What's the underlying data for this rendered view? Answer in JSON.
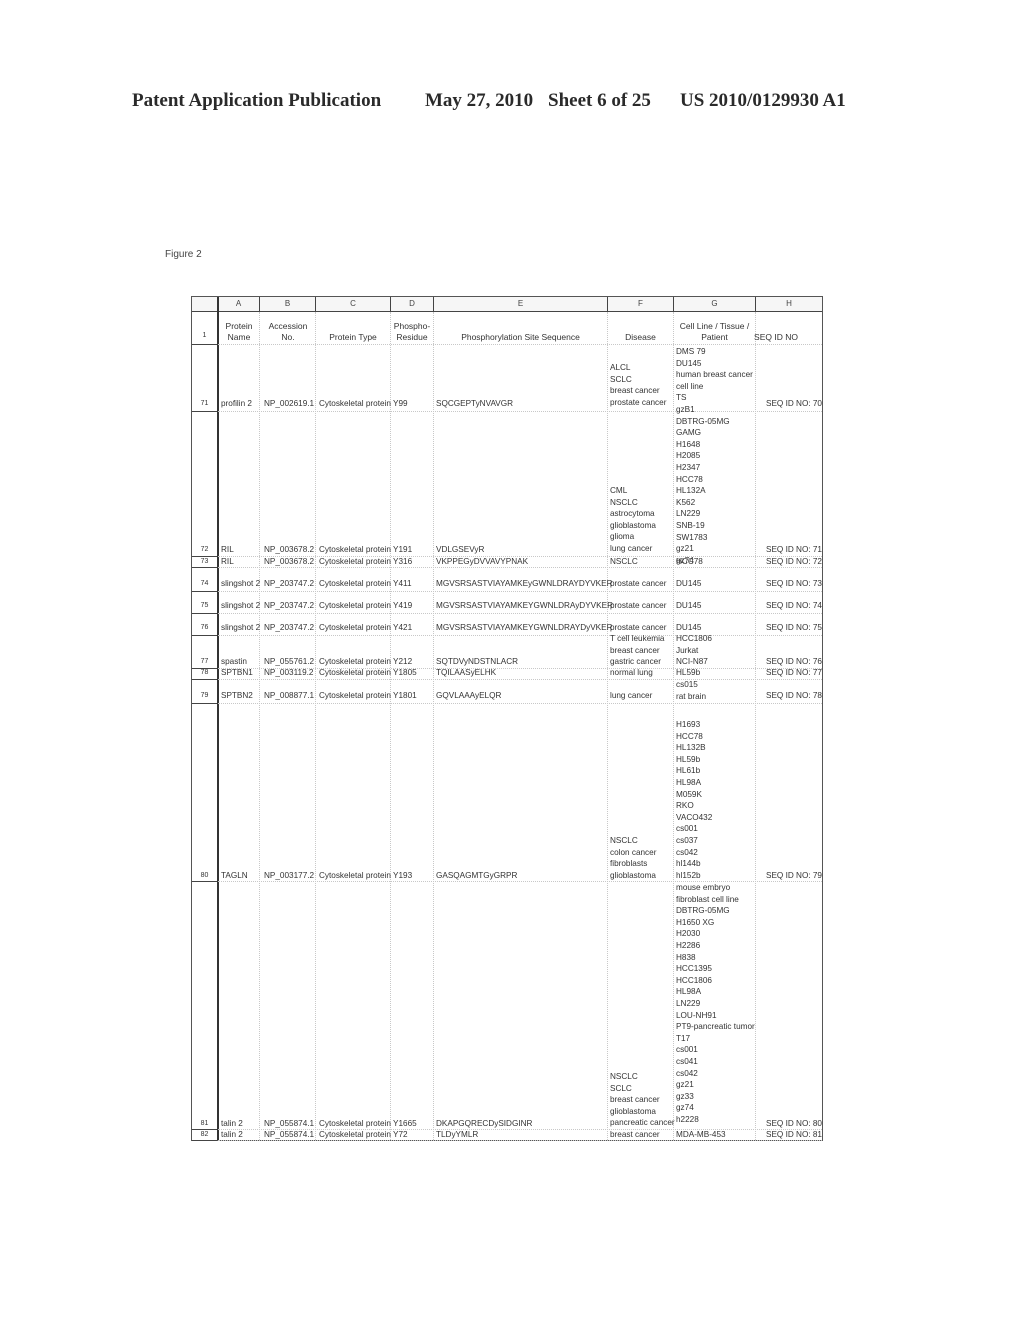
{
  "page_header": {
    "publication": "Patent Application Publication",
    "date": "May 27, 2010",
    "sheet": "Sheet 6 of 25",
    "patent_number": "US 2010/0129930 A1"
  },
  "figure_label": "Figure 2",
  "table": {
    "column_letters": [
      "A",
      "B",
      "C",
      "D",
      "E",
      "F",
      "G",
      "H"
    ],
    "header_row_number": "1",
    "headers": {
      "protein_name": "Protein Name",
      "accession_no": "Accession No.",
      "protein_type": "Protein Type",
      "phospho_residue": "Phospho-Residue",
      "sequence": "Phosphorylation Site Sequence",
      "disease": "Disease",
      "cell_line": "Cell Line / Tissue / Patient",
      "seq_id": "SEQ ID NO"
    },
    "rows": [
      {
        "num": "71",
        "protein": "profilin 2",
        "accession": "NP_002619.1",
        "type": "Cytoskeletal protein",
        "residue": "Y99",
        "sequence": "SQCGEPTyNVAVGR",
        "disease": [
          "ALCL",
          "SCLC",
          "breast cancer",
          "prostate cancer"
        ],
        "cell_lines": [
          "DMS 79",
          "DU145",
          "human breast cancer",
          "cell line",
          "TS",
          "gzB1",
          "DBTRG-05MG",
          "GAMG",
          "H1648",
          "H2085",
          "H2347",
          "HCC78",
          "HL132A",
          "K562",
          "LN229",
          "SNB-19",
          "SW1783",
          "gz21",
          "gz74"
        ],
        "seq_id": "SEQ ID NO: 70"
      },
      {
        "num": "72",
        "protein": "RIL",
        "accession": "NP_003678.2",
        "type": "Cytoskeletal protein",
        "residue": "Y191",
        "sequence": "VDLGSEVyR",
        "disease": [
          "CML",
          "NSCLC",
          "astrocytoma",
          "glioblastoma",
          "glioma",
          "lung cancer"
        ],
        "cell_lines": [],
        "seq_id": "SEQ ID NO: 71"
      },
      {
        "num": "73",
        "protein": "RIL",
        "accession": "NP_003678.2",
        "type": "Cytoskeletal protein",
        "residue": "Y316",
        "sequence": "VKPPEGyDVVAVYPNAK",
        "disease": [
          "NSCLC"
        ],
        "cell_lines": [
          "HCC78"
        ],
        "seq_id": "SEQ ID NO: 72"
      },
      {
        "num": "74",
        "protein": "slingshot 2",
        "accession": "NP_203747.2",
        "type": "Cytoskeletal protein",
        "residue": "Y411",
        "sequence": "MGVSRSASTVIAYAMKEyGWNLDRAYDYVKER",
        "disease": [
          "prostate cancer"
        ],
        "cell_lines": [
          "DU145"
        ],
        "seq_id": "SEQ ID NO: 73"
      },
      {
        "num": "75",
        "protein": "slingshot 2",
        "accession": "NP_203747.2",
        "type": "Cytoskeletal protein",
        "residue": "Y419",
        "sequence": "MGVSRSASTVIAYAMKEYGWNLDRAyDYVKER",
        "disease": [
          "prostate cancer"
        ],
        "cell_lines": [
          "DU145"
        ],
        "seq_id": "SEQ ID NO: 74"
      },
      {
        "num": "76",
        "protein": "slingshot 2",
        "accession": "NP_203747.2",
        "type": "Cytoskeletal protein",
        "residue": "Y421",
        "sequence": "MGVSRSASTVIAYAMKEYGWNLDRAYDyVKER",
        "disease": [
          "prostate cancer"
        ],
        "cell_lines": [
          "DU145"
        ],
        "seq_id": "SEQ ID NO: 75"
      },
      {
        "num": "77",
        "protein": "spastin",
        "accession": "NP_055761.2",
        "type": "Cytoskeletal protein",
        "residue": "Y212",
        "sequence": "SQTDVyNDSTNLACR",
        "disease": [
          "T cell leukemia",
          "breast cancer",
          "gastric cancer"
        ],
        "cell_lines": [
          "HCC1806",
          "Jurkat",
          "NCI-N87"
        ],
        "seq_id": "SEQ ID NO: 76"
      },
      {
        "num": "78",
        "protein": "SPTBN1",
        "accession": "NP_003119.2",
        "type": "Cytoskeletal protein",
        "residue": "Y1805",
        "sequence": "TQILAASyELHK",
        "disease": [
          "normal lung"
        ],
        "cell_lines": [
          "HL59b"
        ],
        "seq_id": "SEQ ID NO: 77"
      },
      {
        "num": "79",
        "protein": "SPTBN2",
        "accession": "NP_008877.1",
        "type": "Cytoskeletal protein",
        "residue": "Y1801",
        "sequence": "GQVLAAAyELQR",
        "disease": [
          "lung cancer"
        ],
        "cell_lines": [
          "cs015",
          "rat brain"
        ],
        "seq_id": "SEQ ID NO: 78"
      },
      {
        "num": "80",
        "protein": "TAGLN",
        "accession": "NP_003177.2",
        "type": "Cytoskeletal protein",
        "residue": "Y193",
        "sequence": "GASQAGMTGyGRPR",
        "disease": [
          "NSCLC",
          "colon cancer",
          "fibroblasts",
          "glioblastoma"
        ],
        "cell_lines": [
          "H1693",
          "HCC78",
          "HL132B",
          "HL59b",
          "HL61b",
          "HL98A",
          "M059K",
          "RKO",
          "VACO432",
          "cs001",
          "cs037",
          "cs042",
          "hl144b",
          "hl152b"
        ],
        "seq_id": "SEQ ID NO: 79"
      },
      {
        "num": "81",
        "protein": "talin 2",
        "accession": "NP_055874.1",
        "type": "Cytoskeletal protein",
        "residue": "Y1665",
        "sequence": "DKAPGQRECDySIDGINR",
        "disease": [
          "NSCLC",
          "SCLC",
          "breast cancer",
          "glioblastoma",
          "pancreatic cancer"
        ],
        "cell_lines": [
          "mouse embryo",
          "fibroblast cell line",
          "DBTRG-05MG",
          "H1650 XG",
          "H2030",
          "H2286",
          "H838",
          "HCC1395",
          "HCC1806",
          "HL98A",
          "LN229",
          "LOU-NH91",
          "PT9-pancreatic tumor",
          "T17",
          "cs001",
          "cs041",
          "cs042",
          "gz21",
          "gz33",
          "gz74",
          "h2228"
        ],
        "seq_id": "SEQ ID NO: 80"
      },
      {
        "num": "82",
        "protein": "talin 2",
        "accession": "NP_055874.1",
        "type": "Cytoskeletal protein",
        "residue": "Y72",
        "sequence": "TLDyYMLR",
        "disease": [
          "breast cancer"
        ],
        "cell_lines": [
          "MDA-MB-453"
        ],
        "seq_id": "SEQ ID NO: 81"
      }
    ]
  }
}
